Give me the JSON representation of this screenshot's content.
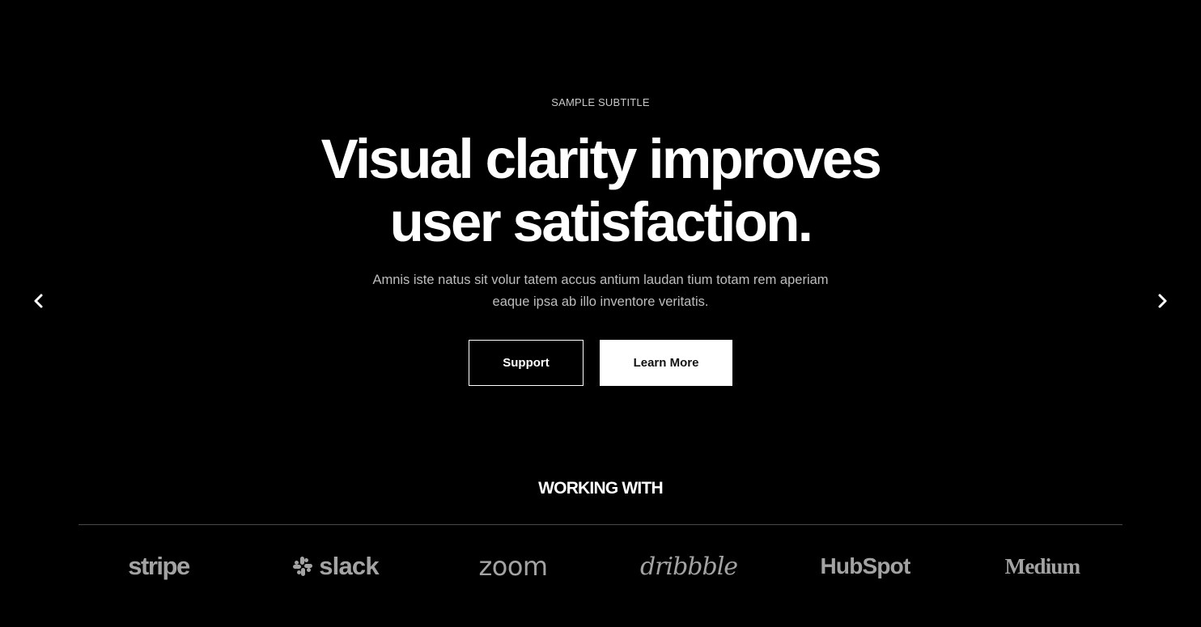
{
  "hero": {
    "subtitle": "SAMPLE SUBTITLE",
    "headline_line1": "Visual clarity improves",
    "headline_line2": "user satisfaction.",
    "description": "Amnis iste natus sit volur tatem accus antium laudan tium totam rem aperiam eaque ipsa ab illo inventore veritatis.",
    "primary_button": "Support",
    "secondary_button": "Learn More",
    "prev_icon": "chevron-left-icon",
    "next_icon": "chevron-right-icon"
  },
  "partners": {
    "title": "WORKING WITH",
    "logos": [
      {
        "name": "stripe",
        "text": "stripe"
      },
      {
        "name": "slack",
        "text": "slack",
        "icon": "slack-logo-icon"
      },
      {
        "name": "zoom",
        "text": "zoom"
      },
      {
        "name": "dribbble",
        "text": "dribbble"
      },
      {
        "name": "hubspot",
        "text": "HubSpot"
      },
      {
        "name": "medium",
        "text": "Medium"
      }
    ]
  },
  "colors": {
    "background": "#000000",
    "text": "#ffffff",
    "muted_text": "#bdbdbd",
    "logo_gray": "#a3a3a3",
    "divider": "#4a4a4a"
  }
}
